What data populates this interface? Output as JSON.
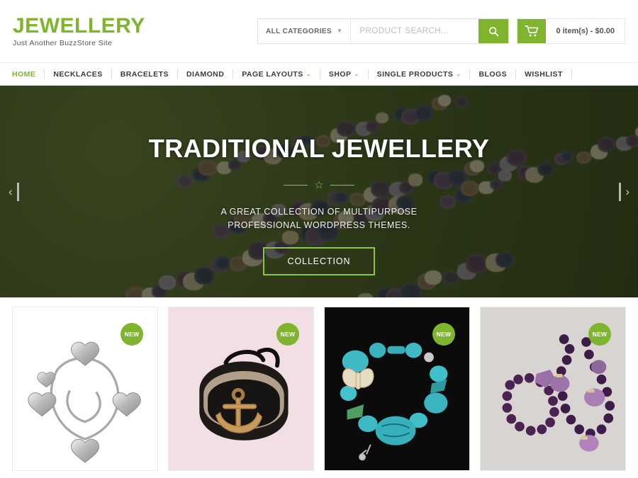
{
  "header": {
    "brand_title": "JEWELLERY",
    "brand_tagline": "Just Another BuzzStore Site",
    "search": {
      "category_label": "ALL CATEGORIES",
      "caret_icon": "chevron-down-icon",
      "placeholder": "PRODUCT SEARCH...",
      "value": "",
      "button_icon": "search-icon"
    },
    "cart": {
      "icon": "shopping-cart-icon",
      "summary": "0 item(s) - $0.00"
    }
  },
  "nav": {
    "items": [
      {
        "label": "HOME",
        "active": true,
        "has_caret": false
      },
      {
        "label": "NECKLACES",
        "active": false,
        "has_caret": false
      },
      {
        "label": "BRACELETS",
        "active": false,
        "has_caret": false
      },
      {
        "label": "DIAMOND",
        "active": false,
        "has_caret": false
      },
      {
        "label": "PAGE LAYOUTS",
        "active": false,
        "has_caret": true
      },
      {
        "label": "SHOP",
        "active": false,
        "has_caret": true
      },
      {
        "label": "SINGLE PRODUCTS",
        "active": false,
        "has_caret": true
      },
      {
        "label": "BLOGS",
        "active": false,
        "has_caret": false
      },
      {
        "label": "WISHLIST",
        "active": false,
        "has_caret": false
      }
    ]
  },
  "hero": {
    "title": "TRADITIONAL JEWELLERY",
    "divider_icon": "star-icon",
    "subtitle": "A GREAT COLLECTION OF MULTIPURPOSE PROFESSIONAL WORDPRESS THEMES.",
    "button_label": "COLLECTION",
    "prev_icon": "chevron-left-icon",
    "next_icon": "chevron-right-icon"
  },
  "products": [
    {
      "name": "silver-heart-charm-bracelet",
      "badge": "NEW",
      "background": "#ffffff"
    },
    {
      "name": "black-leather-anchor-bracelet",
      "badge": "NEW",
      "background": "#f2dfe4"
    },
    {
      "name": "turquoise-butterfly-bracelet",
      "badge": "NEW",
      "background": "#0b0b0b"
    },
    {
      "name": "purple-amethyst-bead-necklace",
      "badge": "NEW",
      "background": "#d8d4d1"
    }
  ],
  "colors": {
    "accent_green": "#7fb52e",
    "hero_green": "#8cc63f",
    "nav_text": "#3b3b3b",
    "hero_bg": "#3f4d22"
  }
}
